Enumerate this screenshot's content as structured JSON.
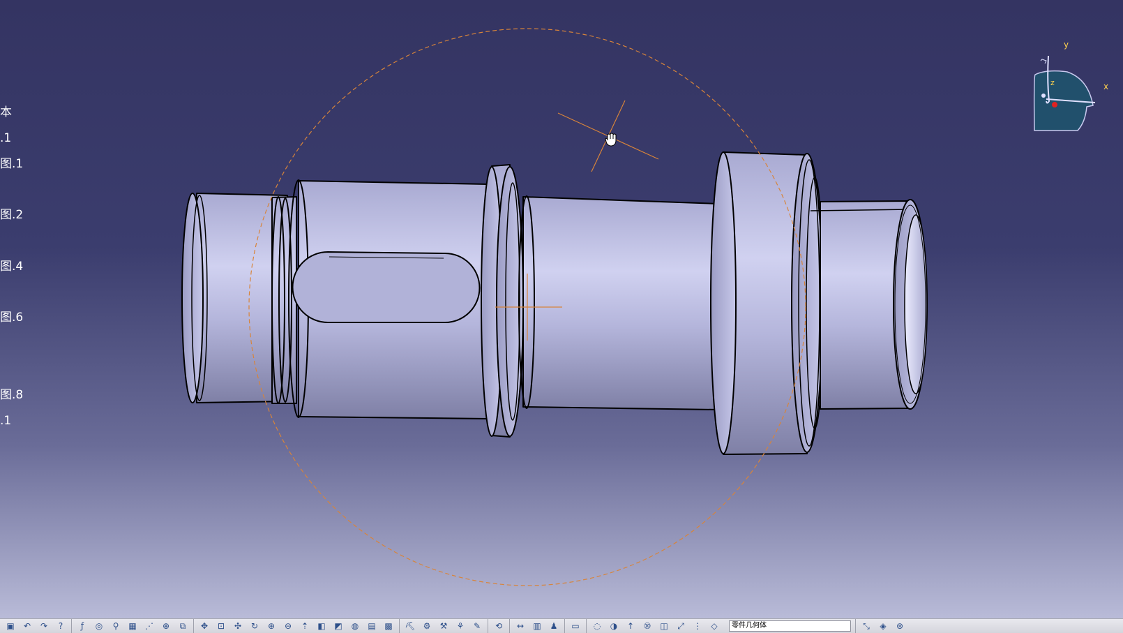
{
  "tree": {
    "items": [
      {
        "label": "本"
      },
      {
        "label": ".1"
      },
      {
        "label": "图.1"
      },
      {
        "label": "图.2"
      },
      {
        "label": "图.4"
      },
      {
        "label": "图.6"
      },
      {
        "label": "图.8"
      },
      {
        "label": ".1"
      }
    ]
  },
  "compass": {
    "axis_y": "y",
    "axis_x": "x",
    "axis_z": "z"
  },
  "colors": {
    "background_top": "#343462",
    "background_bottom": "#b9bbd8",
    "part_fill": "#b9badf",
    "part_edge": "#000000",
    "rotation_guide": "#d8843a",
    "compass_fill": "#21506c"
  },
  "model": {
    "name": "stepped-shaft",
    "features": [
      "keyway",
      "groove",
      "collar",
      "bore"
    ]
  },
  "toolbar": {
    "icons": [
      "save-icon",
      "undo-icon",
      "redo-icon",
      "help-icon",
      "formula-icon",
      "catalog-icon",
      "measure-icon",
      "grid-icon",
      "snap-icon",
      "lock-icon",
      "link-icon",
      "pan-icon",
      "fit-all-icon",
      "rotate-icon",
      "zoom-in-icon",
      "zoom-out-icon",
      "normal-view-icon",
      "iso-view-icon",
      "shading-icon",
      "hide-show-icon",
      "swap-icon",
      "render-icon",
      "select-icon",
      "settings-icon",
      "tools-icon",
      "analysis-icon",
      "sketch-icon",
      "update-icon",
      "compass-icon",
      "measure-between-icon",
      "inertia-icon",
      "pointer-icon",
      "apply-material-icon",
      "constraint-icon",
      "dimension-icon",
      "annotation-icon",
      "plane-icon",
      "cylinder-icon",
      "frame-icon",
      "axis-icon",
      "view-icon",
      "rescale-icon",
      "3d-icon"
    ],
    "combo_value": "零件几何体"
  }
}
